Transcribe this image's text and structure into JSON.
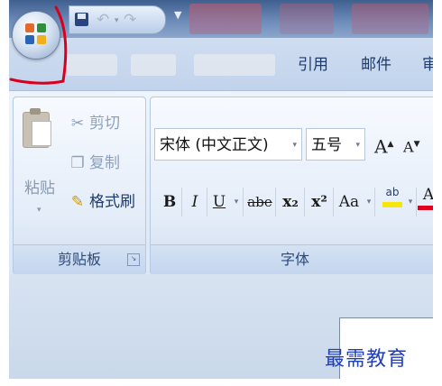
{
  "tabs": [
    "引用",
    "邮件"
  ],
  "clipboard": {
    "paste": "粘贴",
    "cut": "剪切",
    "copy": "复制",
    "format_painter": "格式刷",
    "group_label": "剪贴板"
  },
  "font_group": {
    "font_name": "宋体 (中文正文)",
    "font_size": "五号",
    "group_label": "字体",
    "bold": "B",
    "italic": "I",
    "underline": "U",
    "strikethrough": "abe",
    "subscript": "x₂",
    "superscript": "x²",
    "change_case": "Aa",
    "grow_font": "A",
    "shrink_font": "A"
  },
  "watermark": "最需教育",
  "colors": {
    "annotation_red": "#d8001c",
    "text_dark": "#1f3b6b",
    "highlight_yellow": "#f6e60a",
    "font_color_red": "#e0001b"
  },
  "icons": {
    "office": "office-logo-icon",
    "save": "save-icon",
    "undo": "undo-icon",
    "redo": "redo-icon",
    "cut": "scissors-icon",
    "copy": "copy-icon",
    "format_painter": "brush-icon",
    "paste": "clipboard-icon"
  }
}
